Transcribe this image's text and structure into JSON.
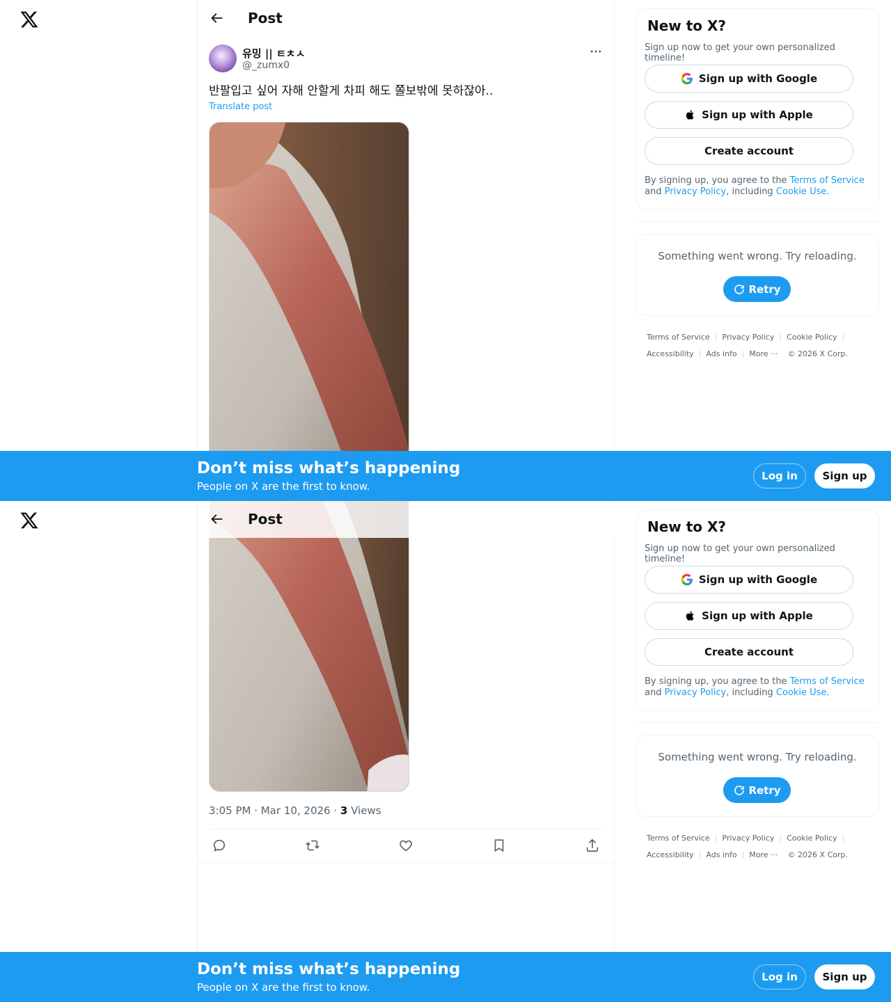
{
  "post": {
    "page_title": "Post",
    "user_name": "유밍 || ㅌㅊㅅ",
    "user_handle": "@_zumx0",
    "text": "반팔입고 싶어 자해 안할게 차피 해도 쫄보밖에 못하잖아..",
    "translate_label": "Translate post",
    "time": "3:05 PM · Mar 10, 2026 · ",
    "views_count": "3",
    "views_label": " Views"
  },
  "signup_card": {
    "title": "New to X?",
    "subtitle": "Sign up now to get your own personalized timeline!",
    "google_label": "Sign up with Google",
    "apple_label": "Sign up with Apple",
    "create_label": "Create account",
    "legal_prefix": "By signing up, you agree to the ",
    "terms_link": "Terms of Service",
    "legal_and": " and ",
    "privacy_link": "Privacy Policy",
    "legal_including": ", including ",
    "cookie_link": "Cookie Use",
    "legal_end": "."
  },
  "error_card": {
    "message": "Something went wrong. Try reloading.",
    "retry_label": "Retry"
  },
  "footer": {
    "terms": "Terms of Service",
    "privacy": "Privacy Policy",
    "cookie": "Cookie Policy",
    "accessibility": "Accessibility",
    "ads": "Ads info",
    "more": "More ···",
    "copyright": "© 2026 X Corp."
  },
  "banner": {
    "title": "Don’t miss what’s happening",
    "subtitle": "People on X are the first to know.",
    "login_label": "Log in",
    "signup_label": "Sign up"
  },
  "colors": {
    "accent": "#1d9bf0",
    "text": "#0f1419",
    "secondary": "#536471"
  }
}
